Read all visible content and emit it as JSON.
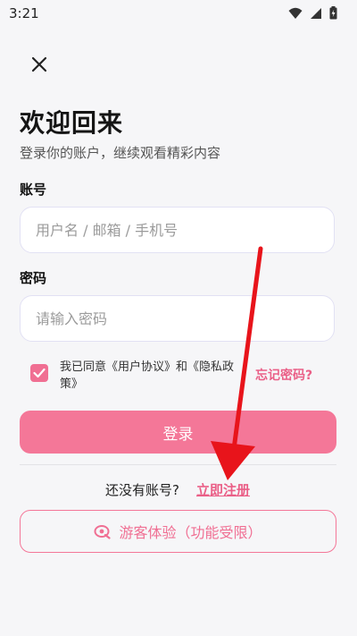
{
  "status_bar": {
    "time": "3:21"
  },
  "header": {
    "title": "欢迎回来",
    "subtitle": "登录你的账户，继续观看精彩内容"
  },
  "form": {
    "account_label": "账号",
    "account_placeholder": "用户名 / 邮箱 / 手机号",
    "account_value": "",
    "password_label": "密码",
    "password_placeholder": "请输入密码",
    "password_value": "",
    "agreement_checked": true,
    "agreement_text": "我已同意《用户协议》和《隐私政策》",
    "forgot_password": "忘记密码?"
  },
  "actions": {
    "login_label": "登录",
    "no_account_text": "还没有账号?",
    "register_label": "立即注册",
    "guest_label": "游客体验（功能受限）"
  },
  "colors": {
    "accent": "#f47798",
    "accent_text": "#ea5f87",
    "annotation_arrow": "#e8141b"
  },
  "icons": {
    "close": "close-icon",
    "checkbox": "checkmark-icon",
    "guest": "guest-eye-icon",
    "wifi": "wifi-icon",
    "signal": "signal-icon",
    "battery": "battery-icon"
  }
}
